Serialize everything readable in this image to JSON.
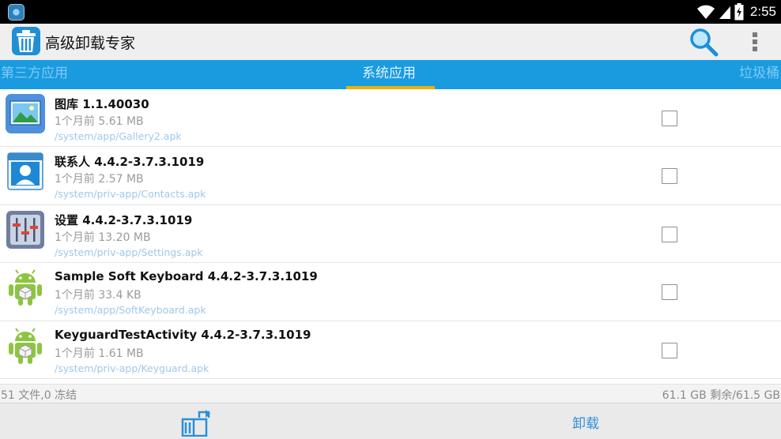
{
  "status_bar": {
    "time": "2:55"
  },
  "app": {
    "title": "高级卸载专家"
  },
  "tabs": [
    {
      "label": "第三方应用",
      "active": false
    },
    {
      "label": "系统应用",
      "active": true
    },
    {
      "label": "垃圾桶",
      "active": false
    }
  ],
  "apps": [
    {
      "name": "图库 1.1.40030",
      "meta": "1个月前 5.61 MB",
      "path": "/system/app/Gallery2.apk",
      "icon": "gallery-icon",
      "checked": false
    },
    {
      "name": "联系人 4.4.2-3.7.3.1019",
      "meta": "1个月前 2.57 MB",
      "path": "/system/priv-app/Contacts.apk",
      "icon": "contacts-icon",
      "checked": false
    },
    {
      "name": "设置 4.4.2-3.7.3.1019",
      "meta": "1个月前 13.20 MB",
      "path": "/system/priv-app/Settings.apk",
      "icon": "settings-icon",
      "checked": false
    },
    {
      "name": "Sample Soft Keyboard 4.4.2-3.7.3.1019",
      "meta": "1个月前 33.4 KB",
      "path": "/system/app/SoftKeyboard.apk",
      "icon": "android-icon",
      "checked": false
    },
    {
      "name": "KeyguardTestActivity 4.4.2-3.7.3.1019",
      "meta": "1个月前 1.61 MB",
      "path": "/system/priv-app/Keyguard.apk",
      "icon": "android-icon",
      "checked": false
    }
  ],
  "summary": {
    "left": "51 文件,0 冻结",
    "right": "61.1 GB 剩余/61.5 GB"
  },
  "bottom": {
    "uninstall_label": "卸载"
  },
  "colors": {
    "tab_bar": "#1a9be0",
    "tab_indicator": "#f0b000",
    "action_text": "#2f8fd8"
  }
}
